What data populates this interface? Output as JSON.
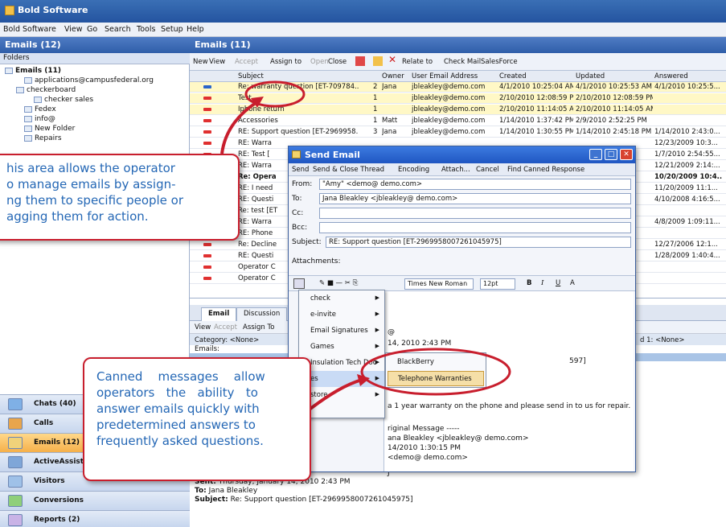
{
  "app": {
    "title": "Bold Software"
  },
  "menu": [
    "Bold Software",
    "View",
    "Go",
    "Search",
    "Tools",
    "Setup",
    "Help"
  ],
  "left": {
    "title": "Emails (12)",
    "folders_label": "Folders",
    "tree": [
      "Emails (11)",
      "applications@campusfederal.org",
      "checkerboard",
      "checker sales",
      "Fedex",
      "info@",
      "New Folder",
      "Repairs"
    ],
    "nav": [
      "Chats (40)",
      "Calls",
      "Emails (12)",
      "ActiveAssist",
      "Visitors",
      "Conversions",
      "Reports (2)"
    ]
  },
  "right": {
    "title": "Emails (11)",
    "toolbar": [
      "New",
      "View",
      "Accept",
      "Assign to",
      "Open",
      "Close",
      "Relate to",
      "Check Mail",
      "SalesForce"
    ],
    "columns": [
      "Subject",
      "Owner",
      "User Email Address",
      "Created",
      "Updated",
      "Answered"
    ],
    "rows": [
      {
        "subject": "Re: warranty question  [ET-709784...",
        "n": "2",
        "owner": "Jana",
        "email": "jbleakley@demo.com",
        "created": "4/1/2010 10:25:04 AM",
        "updated": "4/1/2010 10:25:53 AM",
        "answered": "4/1/2010 10:25:5..."
      },
      {
        "subject": "Test",
        "n": "1",
        "owner": "",
        "email": "jbleakley@demo.com",
        "created": "2/10/2010 12:08:59 PM",
        "updated": "2/10/2010 12:08:59 PM",
        "answered": ""
      },
      {
        "subject": "Iphone return",
        "n": "1",
        "owner": "",
        "email": "jbleakley@demo.com",
        "created": "2/10/2010 11:14:05 AM",
        "updated": "2/10/2010 11:14:05 AM",
        "answered": ""
      },
      {
        "subject": "Accessories",
        "n": "1",
        "owner": "Matt",
        "email": "jbleakley@demo.com",
        "created": "1/14/2010 1:37:42 PM",
        "updated": "2/9/2010 2:52:25 PM",
        "answered": ""
      },
      {
        "subject": "RE: Support question  [ET-2969958...",
        "n": "3",
        "owner": "Jana",
        "email": "jbleakley@demo.com",
        "created": "1/14/2010 1:30:55 PM",
        "updated": "1/14/2010 2:45:18 PM",
        "answered": "1/14/2010 2:43:0..."
      },
      {
        "subject": "RE: Warra",
        "answered": "12/23/2009 10:3..."
      },
      {
        "subject": "RE: Test [",
        "answered": "1/7/2010 2:54:55..."
      },
      {
        "subject": "RE: Warra",
        "answered": "12/21/2009 2:14:..."
      },
      {
        "subject": "Re: Opera",
        "answered": "10/20/2009 10:4..."
      },
      {
        "subject": "RE: I need",
        "answered": "11/20/2009 11:1..."
      },
      {
        "subject": "RE: Questi",
        "answered": "4/10/2008 4:16:5..."
      },
      {
        "subject": "Re: test [ET",
        "answered": ""
      },
      {
        "subject": "RE: Warra",
        "answered": "4/8/2009 1:09:11..."
      },
      {
        "subject": "RE: Phone",
        "answered": ""
      },
      {
        "subject": "Re: Decline",
        "answered": "12/27/2006 12:1..."
      },
      {
        "subject": "RE: Questi",
        "answered": "1/28/2009 1:40:4..."
      },
      {
        "subject": "Operator C",
        "answered": ""
      },
      {
        "subject": "Operator C",
        "answered": ""
      }
    ]
  },
  "lower": {
    "tabs": [
      "Email",
      "Discussion"
    ],
    "toolbar": [
      "View",
      "Accept",
      "Assign To"
    ],
    "category": "Category:  <None>",
    "emails_label": "Emails:",
    "field_right": "d 1:  <None>",
    "sent": "Sent:",
    "sent_val": "Thursday, January 14, 2010 2:43 PM",
    "to": "To:",
    "to_val": "Jana Bleakley",
    "subject": "Subject:",
    "subject_val": "Re: Support question [ET-2969958007261045975]",
    "frag": "J"
  },
  "dialog": {
    "title": "Send Email",
    "toolbar": [
      "Send",
      "Send & Close Thread",
      "Encoding",
      "Attach...",
      "Cancel",
      "Find Canned Response"
    ],
    "from_label": "From:",
    "from": "\"Amy\" <demo@ demo.com>",
    "to_label": "To:",
    "to": "Jana Bleakley <jbleakley@ demo.com>",
    "cc_label": "Cc:",
    "bcc_label": "Bcc:",
    "subject_label": "Subject:",
    "subject": "RE: Support question  [ET-2969958007261045975]",
    "attach_label": "Attachments:",
    "font": "Times New Roman",
    "size": "12pt",
    "body": [
      "@",
      "14, 2010 2:43 PM",
      "597]",
      "a 1 year warranty on the phone and please send in to us for repair.",
      "riginal Message -----",
      "ana Bleakley <jbleakley@ demo.com>",
      "14/2010 1:30:15 PM",
      "<demo@ demo.com>"
    ]
  },
  "canned_menu": [
    "check",
    "e-invite",
    "Email Signatures",
    "Games",
    "Insulation Tech Doc",
    "es",
    "store"
  ],
  "submenu": [
    "BlackBerry",
    "Telephone Warranties"
  ],
  "callouts": {
    "top": [
      "his area allows the operator",
      "o manage emails by assign-",
      "ng them to specific people or",
      "agging them for action."
    ],
    "bottom": [
      "Canned    messages    allow",
      "operators   the   ability   to",
      "answer emails quickly with",
      "predetermined answers to",
      "frequently asked questions."
    ]
  },
  "colors": {
    "accent": "#2f5ea9",
    "callout_border": "#c81e2d",
    "callout_text": "#2467b5",
    "highlight": "#fff8c6"
  }
}
